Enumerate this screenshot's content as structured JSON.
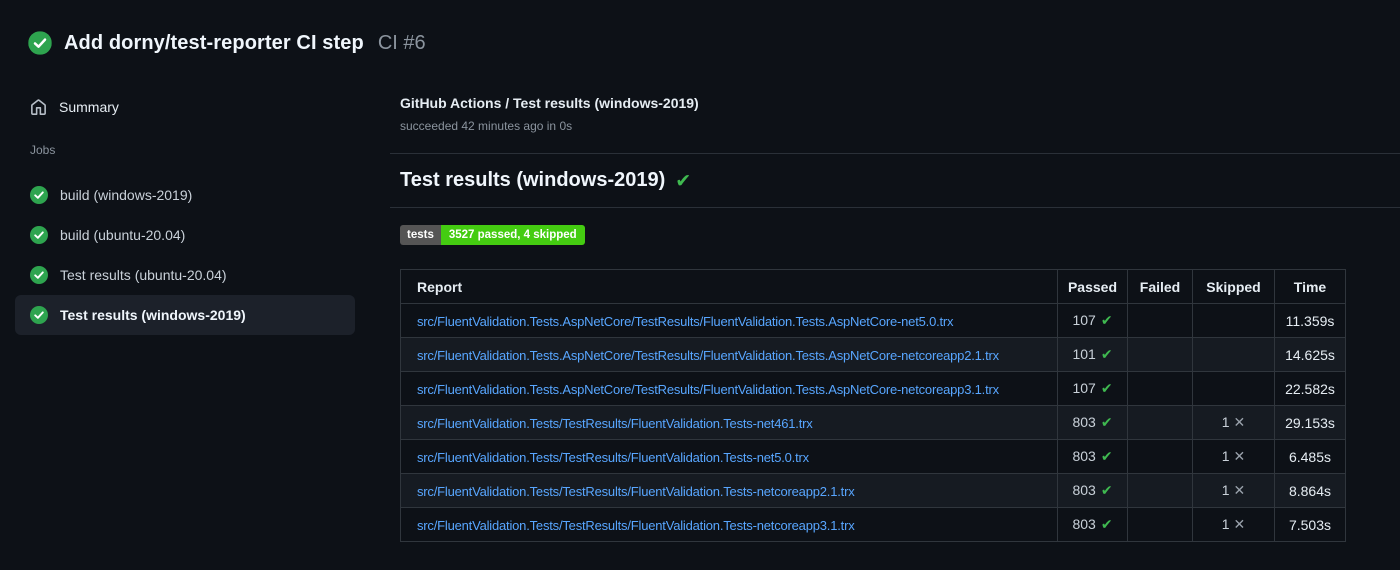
{
  "run_header": {
    "title": "Add dorny/test-reporter CI step",
    "run_label": "CI #6"
  },
  "sidebar": {
    "summary_label": "Summary",
    "jobs_label": "Jobs",
    "jobs": [
      {
        "label": "build (windows-2019)",
        "selected": false
      },
      {
        "label": "build (ubuntu-20.04)",
        "selected": false
      },
      {
        "label": "Test results (ubuntu-20.04)",
        "selected": false
      },
      {
        "label": "Test results (windows-2019)",
        "selected": true
      }
    ]
  },
  "main": {
    "check_title": "GitHub Actions / Test results (windows-2019)",
    "check_status": "succeeded 42 minutes ago in 0s",
    "heading": "Test results (windows-2019)",
    "badge": {
      "label": "tests",
      "value": "3527 passed, 4 skipped",
      "label_bg": "#555555",
      "value_bg": "#44cc11"
    },
    "table": {
      "headers": [
        "Report",
        "Passed",
        "Failed",
        "Skipped",
        "Time"
      ],
      "rows": [
        {
          "report": "src/FluentValidation.Tests.AspNetCore/TestResults/FluentValidation.Tests.AspNetCore-net5.0.trx",
          "passed": "107",
          "failed": "",
          "skipped": "",
          "time": "11.359s"
        },
        {
          "report": "src/FluentValidation.Tests.AspNetCore/TestResults/FluentValidation.Tests.AspNetCore-netcoreapp2.1.trx",
          "passed": "101",
          "failed": "",
          "skipped": "",
          "time": "14.625s"
        },
        {
          "report": "src/FluentValidation.Tests.AspNetCore/TestResults/FluentValidation.Tests.AspNetCore-netcoreapp3.1.trx",
          "passed": "107",
          "failed": "",
          "skipped": "",
          "time": "22.582s"
        },
        {
          "report": "src/FluentValidation.Tests/TestResults/FluentValidation.Tests-net461.trx",
          "passed": "803",
          "failed": "",
          "skipped": "1",
          "time": "29.153s"
        },
        {
          "report": "src/FluentValidation.Tests/TestResults/FluentValidation.Tests-net5.0.trx",
          "passed": "803",
          "failed": "",
          "skipped": "1",
          "time": "6.485s"
        },
        {
          "report": "src/FluentValidation.Tests/TestResults/FluentValidation.Tests-netcoreapp2.1.trx",
          "passed": "803",
          "failed": "",
          "skipped": "1",
          "time": "8.864s"
        },
        {
          "report": "src/FluentValidation.Tests/TestResults/FluentValidation.Tests-netcoreapp3.1.trx",
          "passed": "803",
          "failed": "",
          "skipped": "1",
          "time": "7.503s"
        }
      ]
    }
  },
  "icons": {
    "passed_check": "✔",
    "skipped_x": "✕",
    "heading_check": "✔"
  },
  "colors": {
    "background": "#0d1117",
    "success_circle_green": "#2ea44f",
    "check_green": "#3fb950",
    "link_blue": "#58a6ff",
    "table_border": "#30363d",
    "row_stripe": "#161b22",
    "selected_item_bg": "#1c212a",
    "muted_text": "#8b949e"
  }
}
